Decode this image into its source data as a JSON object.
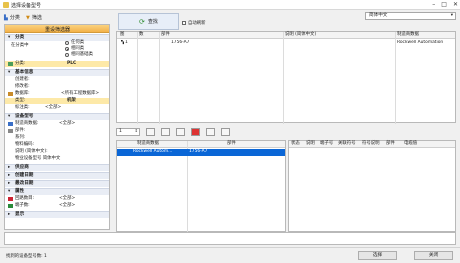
{
  "window": {
    "title": "选择设备型号",
    "controls": [
      "–",
      "□",
      "✕"
    ]
  },
  "toolbar": {
    "category_label": "分类",
    "filter_label": "筛选"
  },
  "left": {
    "filter_header": "重设筛选器",
    "sections": {
      "category": "分类",
      "basic": "基本信息",
      "device_model": "设备型号",
      "supply": "供应商",
      "created_date": "创建日期",
      "modified_date": "最改日期",
      "attr": "属性",
      "display": "显示"
    },
    "category_rows": {
      "in_category": "在分类中",
      "opt_any": "任何类",
      "opt_same": "相同类",
      "opt_same_base": "相同基础类",
      "category_label": "分类:",
      "category_value": "PLC"
    },
    "basic_rows": {
      "creator": "创建者:",
      "modifier": "修改者:",
      "db_label": "数据库:",
      "db_value": "<所有工程数据库>",
      "type_label": "类型:",
      "type_value": "机架",
      "std_label": "标注类:",
      "std_value": "<全部>"
    },
    "model_rows": {
      "manufacturer": "制造商数据:",
      "manufacturer_value": "<全部>",
      "part": "部件:",
      "series": "系列:",
      "material": "物料编码:",
      "desc": "说明 (简体中文):",
      "pkg": "物业设备型号 简体中文"
    },
    "attr_rows": {
      "circuit": "回路数目:",
      "circuit_value": "<全部>",
      "terminal": "端子数:",
      "terminal_value": "<全部>"
    }
  },
  "search": {
    "label": "查找",
    "auto_refresh": "自动刷新"
  },
  "lang": {
    "selected": "简体中文"
  },
  "top_grid": {
    "headers": [
      "图",
      "数",
      "部件",
      "说明 (简体中文)",
      "制造商数据"
    ],
    "rows": [
      {
        "num": "1",
        "part": "1756-A7",
        "desc": "",
        "manufacturer": "Rockwell Automation"
      }
    ]
  },
  "mid": {
    "qty": "1"
  },
  "bottom_grid": {
    "headers": [
      "制造商数据",
      "部件"
    ],
    "rows": [
      {
        "manufacturer": "Rockwell Autom...",
        "part": "1756-A7"
      }
    ]
  },
  "detail_grid": {
    "headers": [
      "状态",
      "说明",
      "端子号",
      "关联符号",
      "符号说明",
      "部件",
      "电缆值"
    ]
  },
  "footer": {
    "status": "找到的设备型号数: 1",
    "ok": "选择",
    "close": "关闭"
  }
}
